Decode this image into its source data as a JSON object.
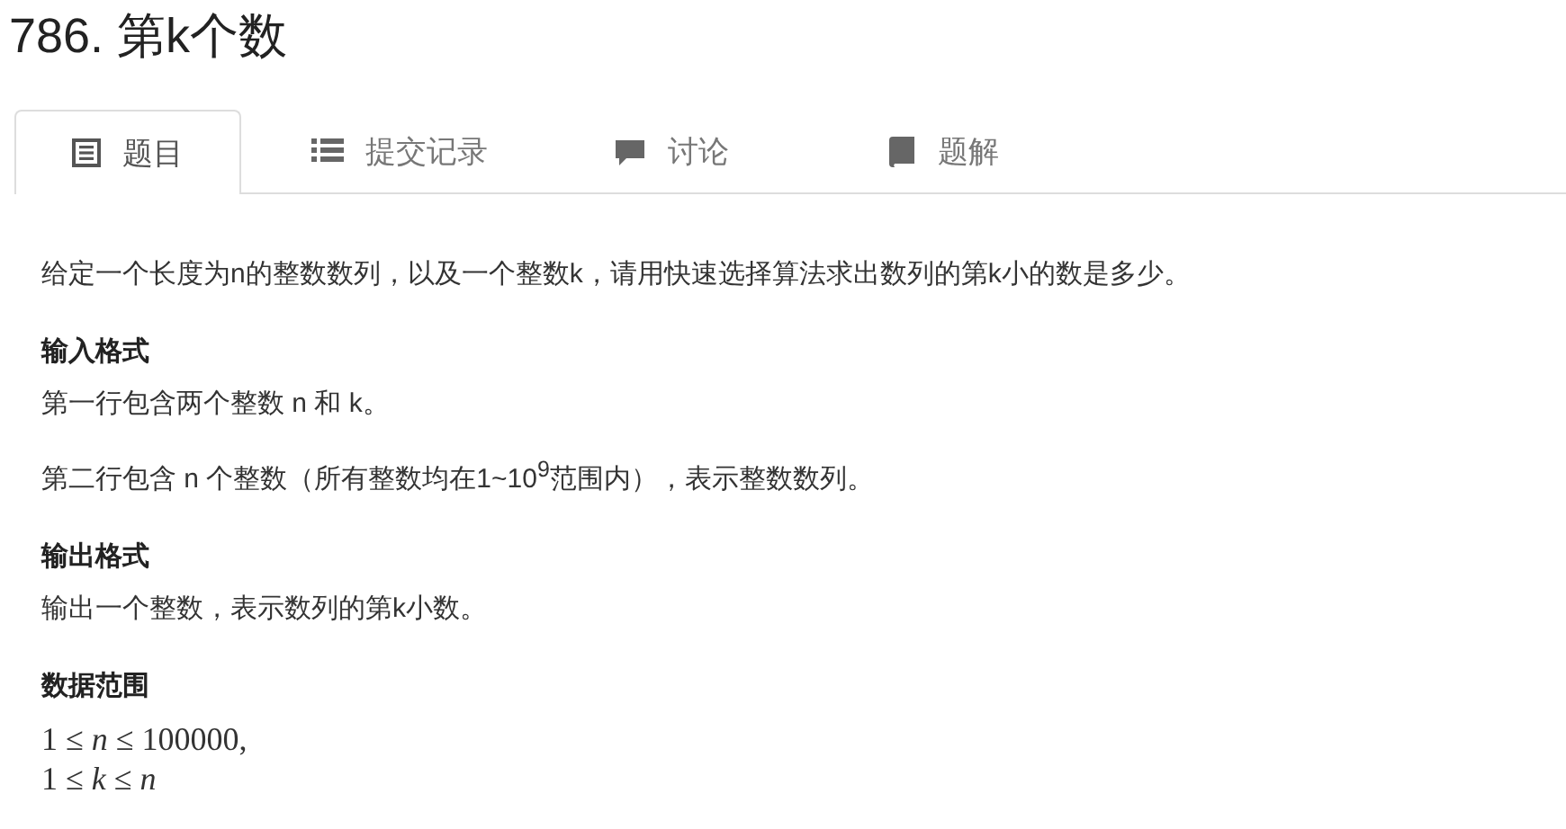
{
  "title": "786. 第k个数",
  "tabs": [
    {
      "label": "题目",
      "kind": "document",
      "selected": true
    },
    {
      "label": "提交记录",
      "kind": "list",
      "selected": false
    },
    {
      "label": "讨论",
      "kind": "comment",
      "selected": false
    },
    {
      "label": "题解",
      "kind": "book",
      "selected": false
    }
  ],
  "sections": [
    {
      "kind": "paragraph",
      "text": "给定一个长度为n的整数数列，以及一个整数k，请用快速选择算法求出数列的第k小的数是多少。"
    },
    {
      "kind": "heading",
      "text": "输入格式"
    },
    {
      "kind": "paragraph",
      "text": "第一行包含两个整数 n 和 k。"
    },
    {
      "kind": "paragraph",
      "text": "第二行包含 n 个整数（所有整数均在1~10$^{9}$范围内），表示整数数列。"
    },
    {
      "kind": "heading",
      "text": "输出格式"
    },
    {
      "kind": "paragraph",
      "text": "输出一个整数，表示数列的第k小数。"
    },
    {
      "kind": "heading",
      "text": "数据范围"
    },
    {
      "kind": "math",
      "text": "1 ≤ *n* ≤ 100000,"
    },
    {
      "kind": "math",
      "text": "1 ≤ *k* ≤ *n*"
    }
  ]
}
